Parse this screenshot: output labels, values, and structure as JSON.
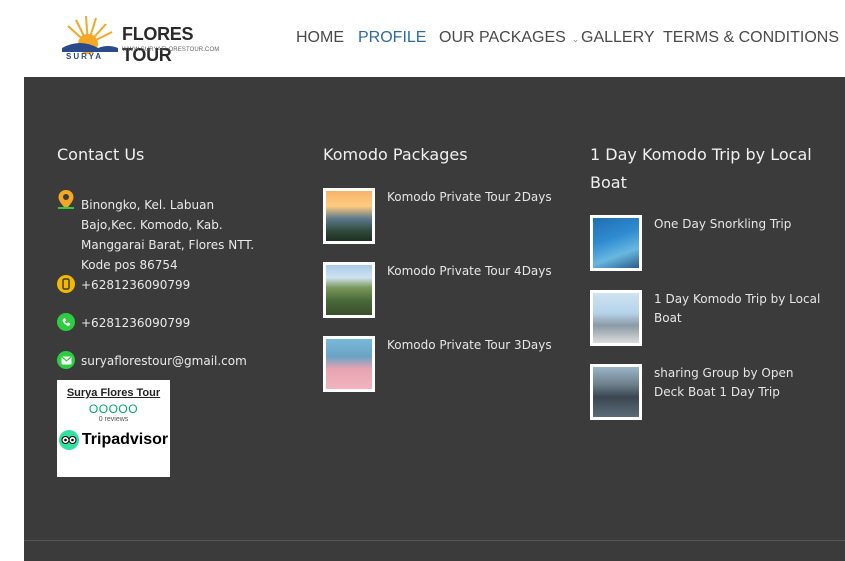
{
  "brand": {
    "title": "FLORES TOUR",
    "url": "WWW.SURYAFLORESTOUR.COM",
    "mark": "SURYA"
  },
  "nav": [
    {
      "label": "HOME",
      "active": false
    },
    {
      "label": "PROFILE",
      "active": true
    },
    {
      "label": "OUR PACKAGES",
      "active": false,
      "dropdown": true
    },
    {
      "label": "GALLERY",
      "active": false
    },
    {
      "label": "TERMS & CONDITIONS",
      "active": false
    }
  ],
  "footer": {
    "contact": {
      "title": "Contact Us",
      "address": "Binongko, Kel. Labuan Bajo,Kec. Komodo, Kab. Manggarai Barat, Flores NTT. Kode pos 86754",
      "phone": "+6281236090799",
      "whatsapp": "+6281236090799",
      "email": "suryaflorestour@gmail.com",
      "tripadvisor": {
        "name": "Surya Flores Tour",
        "rating_dots": "OOOOO",
        "reviews": "0 reviews",
        "brand": "Tripadvisor"
      }
    },
    "komodo": {
      "title": "Komodo Packages",
      "posts": [
        {
          "title": "Komodo Private Tour 2Days"
        },
        {
          "title": "Komodo Private Tour 4Days"
        },
        {
          "title": "Komodo Private Tour 3Days"
        }
      ]
    },
    "oneday": {
      "title": "1 Day Komodo Trip by Local Boat",
      "posts": [
        {
          "title": "One Day Snorkling Trip"
        },
        {
          "title": "1 Day Komodo Trip by Local Boat"
        },
        {
          "title": "sharing Group by Open Deck Boat 1 Day Trip"
        }
      ]
    }
  },
  "colors": {
    "footer_bg": "#3b3b3b",
    "nav_active": "#2e6b9e",
    "location_icon": "#f5a623",
    "phone_icon": "#f5b800",
    "whatsapp_icon": "#2ecc40",
    "email_icon": "#2ecc40",
    "tripadvisor_green": "#00aa6c"
  },
  "icons": {
    "address": "location-pin-icon",
    "phone": "phone-icon",
    "whatsapp": "whatsapp-icon",
    "email": "email-icon",
    "dropdown": "chevron-down-icon"
  }
}
